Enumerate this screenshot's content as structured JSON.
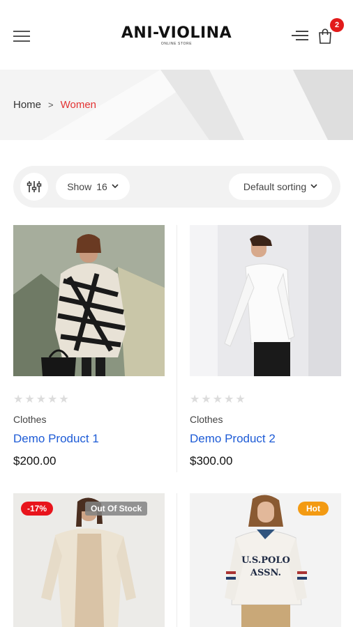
{
  "header": {
    "logo_main": "ANI-VIOLINA",
    "logo_sub": "ONLINE STORE",
    "cart_count": "2"
  },
  "breadcrumb": {
    "home": "Home",
    "separator": ">",
    "current": "Women"
  },
  "toolbar": {
    "show_label": "Show",
    "show_value": "16",
    "sort_label": "Default sorting"
  },
  "colors": {
    "accent_red": "#e33333",
    "link_blue": "#1d5bd6",
    "sale_badge": "#e8141c",
    "hot_badge": "#f39a12"
  },
  "products": [
    {
      "category": "Clothes",
      "name": "Demo Product 1",
      "price": "$200.00",
      "rating": 0
    },
    {
      "category": "Clothes",
      "name": "Demo Product 2",
      "price": "$300.00",
      "rating": 0
    },
    {
      "sale_badge": "-17%",
      "stock_badge": "Out Of Stock"
    },
    {
      "hot_badge": "Hot"
    }
  ],
  "icons": [
    "hamburger-menu-icon",
    "lines-menu-icon",
    "shopping-bag-icon",
    "chevron-right-icon",
    "sliders-filter-icon",
    "chevron-down-icon",
    "star-icon"
  ]
}
